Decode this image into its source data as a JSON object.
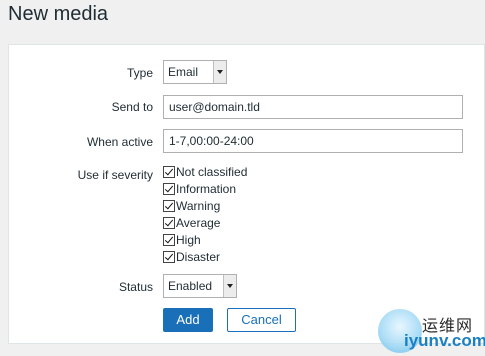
{
  "page": {
    "title": "New media"
  },
  "form": {
    "type": {
      "label": "Type",
      "value": "Email"
    },
    "send_to": {
      "label": "Send to",
      "value": "user@domain.tld"
    },
    "when_active": {
      "label": "When active",
      "value": "1-7,00:00-24:00"
    },
    "severity": {
      "label": "Use if severity",
      "options": [
        {
          "label": "Not classified",
          "checked": true
        },
        {
          "label": "Information",
          "checked": true
        },
        {
          "label": "Warning",
          "checked": true
        },
        {
          "label": "Average",
          "checked": true
        },
        {
          "label": "High",
          "checked": true
        },
        {
          "label": "Disaster",
          "checked": true
        }
      ]
    },
    "status": {
      "label": "Status",
      "value": "Enabled"
    }
  },
  "buttons": {
    "add": "Add",
    "cancel": "Cancel"
  },
  "watermark": {
    "top": "运维网",
    "bottom": "iyunv.com"
  },
  "colors": {
    "primary": "#1a70b8",
    "panel_bg": "#ffffff",
    "page_bg": "#f0f0f0"
  }
}
